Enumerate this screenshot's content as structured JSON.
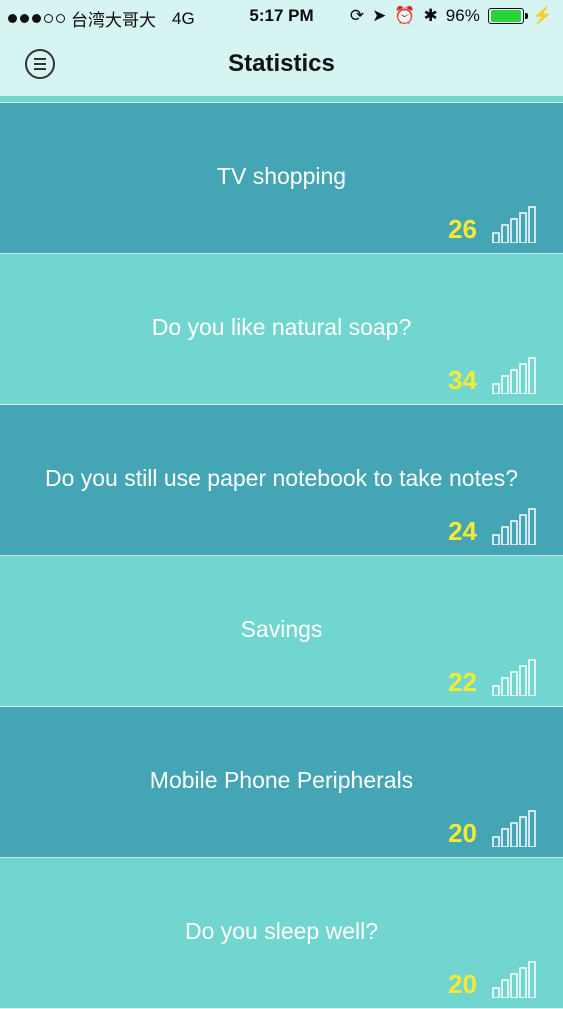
{
  "status": {
    "carrier": "台湾大哥大",
    "network": "4G",
    "time": "5:17 PM",
    "battery": "96%"
  },
  "nav": {
    "title": "Statistics"
  },
  "rows": [
    {
      "question": "TV shopping",
      "count": "26"
    },
    {
      "question": "Do you like natural soap?",
      "count": "34"
    },
    {
      "question": "Do you still use paper notebook to take notes?",
      "count": "24"
    },
    {
      "question": "Savings",
      "count": "22"
    },
    {
      "question": "Mobile Phone Peripherals",
      "count": "20"
    },
    {
      "question": "Do you sleep well?",
      "count": "20"
    }
  ],
  "colors": {
    "dark_row": "#44a5b4",
    "light_row": "#72d6d0",
    "count": "#f6ea33",
    "header": "#d5f4f2"
  }
}
